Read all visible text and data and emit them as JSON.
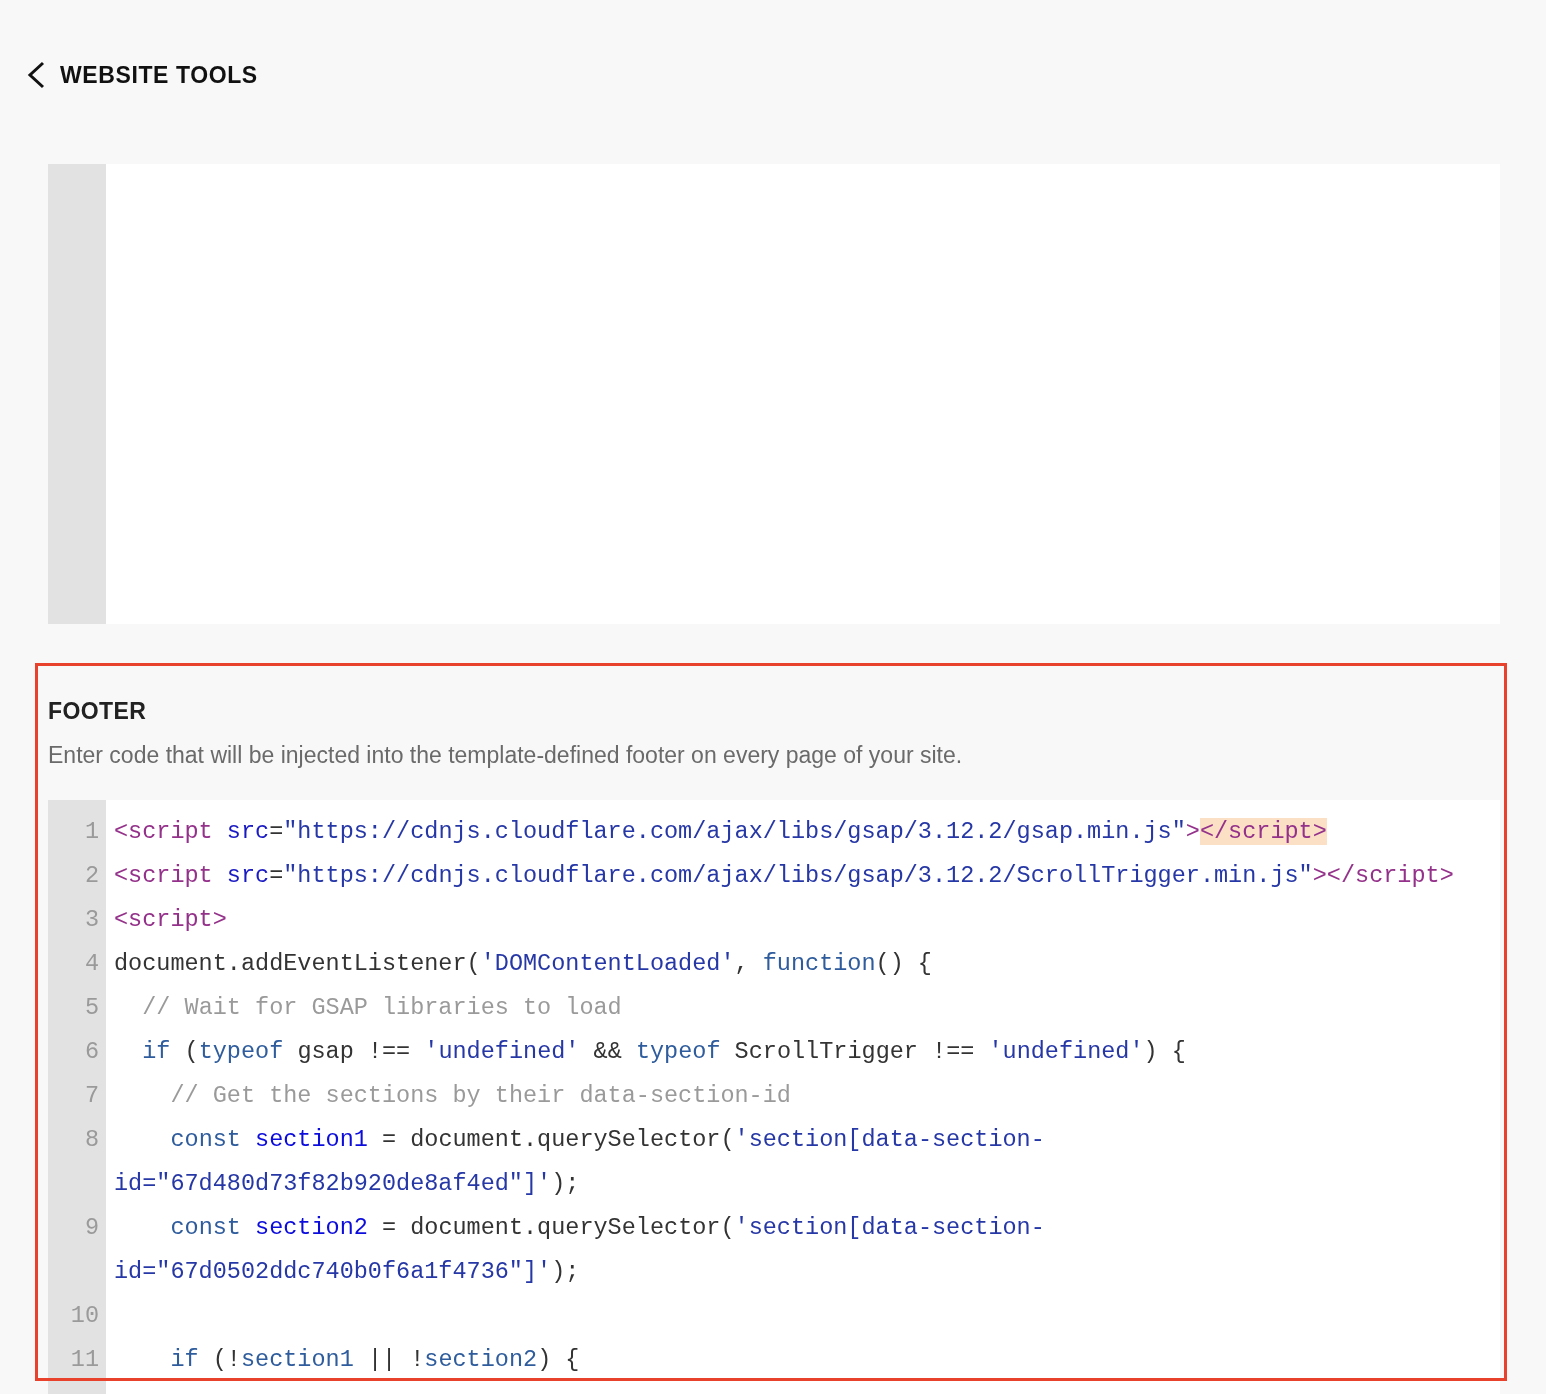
{
  "header": {
    "back_label": "WEBSITE TOOLS"
  },
  "footer": {
    "heading": "FOOTER",
    "description": "Enter code that will be injected into the template-defined footer on every page of your site.",
    "code_lines": [
      {
        "number": "1",
        "rows": [
          [
            {
              "kind": "tag",
              "text": "<script"
            },
            {
              "kind": "plain",
              "text": " "
            },
            {
              "kind": "attr",
              "text": "src"
            },
            {
              "kind": "plain",
              "text": "="
            },
            {
              "kind": "string",
              "text": "\"https://cdnjs.cloudflare.com/ajax/libs/gsap/3.12.2/gsap.min.js\""
            },
            {
              "kind": "tag",
              "text": ">"
            },
            {
              "kind": "matched-tag",
              "text": "</script>"
            }
          ]
        ]
      },
      {
        "number": "2",
        "rows": [
          [
            {
              "kind": "tag",
              "text": "<script"
            },
            {
              "kind": "plain",
              "text": " "
            },
            {
              "kind": "attr",
              "text": "src"
            },
            {
              "kind": "plain",
              "text": "="
            },
            {
              "kind": "string",
              "text": "\"https://cdnjs.cloudflare.com/ajax/libs/gsap/3.12.2/ScrollTrigger.min.js\""
            },
            {
              "kind": "tag",
              "text": "></script>"
            }
          ]
        ]
      },
      {
        "number": "3",
        "rows": [
          [
            {
              "kind": "tag",
              "text": "<script>"
            }
          ]
        ]
      },
      {
        "number": "4",
        "rows": [
          [
            {
              "kind": "plain",
              "text": "document.addEventListener("
            },
            {
              "kind": "string",
              "text": "'DOMContentLoaded'"
            },
            {
              "kind": "plain",
              "text": ", "
            },
            {
              "kind": "keyword",
              "text": "function"
            },
            {
              "kind": "plain",
              "text": "() {"
            }
          ]
        ]
      },
      {
        "number": "5",
        "rows": [
          [
            {
              "kind": "plain",
              "text": "  "
            },
            {
              "kind": "comment",
              "text": "// Wait for GSAP libraries to load"
            }
          ]
        ]
      },
      {
        "number": "6",
        "rows": [
          [
            {
              "kind": "plain",
              "text": "  "
            },
            {
              "kind": "keyword",
              "text": "if"
            },
            {
              "kind": "plain",
              "text": " ("
            },
            {
              "kind": "keyword",
              "text": "typeof"
            },
            {
              "kind": "plain",
              "text": " gsap !== "
            },
            {
              "kind": "string",
              "text": "'undefined'"
            },
            {
              "kind": "plain",
              "text": " && "
            },
            {
              "kind": "keyword",
              "text": "typeof"
            },
            {
              "kind": "plain",
              "text": " ScrollTrigger !== "
            },
            {
              "kind": "string",
              "text": "'undefined'"
            },
            {
              "kind": "plain",
              "text": ") {"
            }
          ]
        ]
      },
      {
        "number": "7",
        "rows": [
          [
            {
              "kind": "plain",
              "text": "    "
            },
            {
              "kind": "comment",
              "text": "// Get the sections by their data-section-id"
            }
          ]
        ]
      },
      {
        "number": "8",
        "rows": [
          [
            {
              "kind": "plain",
              "text": "    "
            },
            {
              "kind": "keyword",
              "text": "const"
            },
            {
              "kind": "plain",
              "text": " "
            },
            {
              "kind": "def",
              "text": "section1"
            },
            {
              "kind": "plain",
              "text": " = document.querySelector("
            },
            {
              "kind": "string",
              "text": "'section[data-section-"
            }
          ]
        ],
        "wrapped": [
          {
            "kind": "string",
            "text": "id=\"67d480d73f82b920de8af4ed\"]'"
          },
          {
            "kind": "plain",
            "text": ");"
          }
        ]
      },
      {
        "number": "9",
        "rows": [
          [
            {
              "kind": "plain",
              "text": "    "
            },
            {
              "kind": "keyword",
              "text": "const"
            },
            {
              "kind": "plain",
              "text": " "
            },
            {
              "kind": "def",
              "text": "section2"
            },
            {
              "kind": "plain",
              "text": " = document.querySelector("
            },
            {
              "kind": "string",
              "text": "'section[data-section-"
            }
          ]
        ],
        "wrapped": [
          {
            "kind": "string",
            "text": "id=\"67d0502ddc740b0f6a1f4736\"]'"
          },
          {
            "kind": "plain",
            "text": ");"
          }
        ]
      },
      {
        "number": "10",
        "rows": [
          []
        ]
      },
      {
        "number": "11",
        "rows": [
          [
            {
              "kind": "plain",
              "text": "    "
            },
            {
              "kind": "keyword",
              "text": "if"
            },
            {
              "kind": "plain",
              "text": " (!"
            },
            {
              "kind": "variable",
              "text": "section1"
            },
            {
              "kind": "plain",
              "text": " || !"
            },
            {
              "kind": "variable",
              "text": "section2"
            },
            {
              "kind": "plain",
              "text": ") {"
            }
          ]
        ]
      }
    ]
  }
}
